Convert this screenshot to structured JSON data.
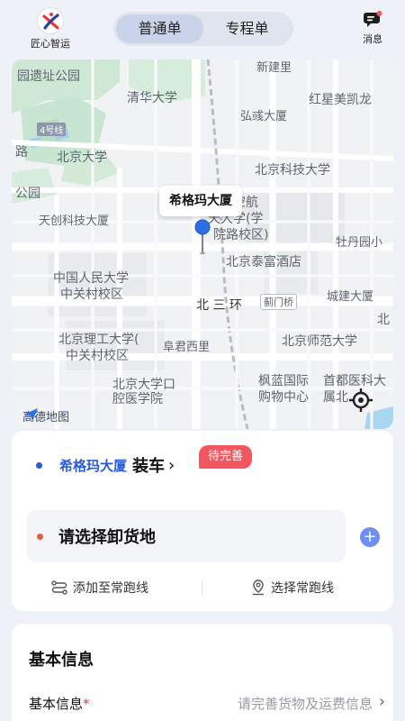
{
  "header": {
    "logo_text": "匠心智运",
    "tabs": [
      {
        "label": "普通单",
        "active": true
      },
      {
        "label": "专程单",
        "active": false
      }
    ],
    "message_label": "消息"
  },
  "map": {
    "labels": {
      "yuan": "园遗址公园",
      "xinjian": "新建里",
      "tsinghua": "清华大学",
      "hongxing": "红星美凯龙",
      "hongyu": "弘彧大厦",
      "road4": "4号线",
      "road_lu": "路",
      "pku": "北京大学",
      "ustb": "北京科技大学",
      "park": "公园",
      "tianchuang": "天创科技大厦",
      "beihang1": "航空航",
      "beihang2": "天大学(学",
      "beihang3": "院路校区)",
      "mudanyuan": "牡丹园小",
      "taifu": "北京泰富酒店",
      "renmin1": "中国人民大学",
      "renmin2": "中关村校区",
      "beisanhuan": "北 三 环",
      "jimenqiao": "蓟门桥",
      "chengjian": "城建大厦",
      "bei": "北",
      "bit1": "北京理工大学(",
      "bit2": "中关村校区",
      "fujun": "阜君西里",
      "bnu": "北京师范大学",
      "pkukq1": "北京大学口",
      "pkukq2": "腔医学院",
      "fenglan1": "枫蓝国际",
      "fenglan2": "购物中心",
      "shoudu1": "首都医科大",
      "shoudu2": "属北",
      "gaode": "高德地图"
    },
    "callout": "希格玛大厦"
  },
  "route": {
    "origin_name": "希格玛大厦",
    "origin_action": "装车",
    "origin_arrow": "›",
    "badge": "待完善",
    "destination_placeholder": "请选择卸货地",
    "add_to_routes": "添加至常跑线",
    "choose_route": "选择常跑线",
    "origin_dot_color": "#2a5bd7",
    "dest_dot_color": "#f05a3c"
  },
  "basic_info": {
    "title": "基本信息",
    "row_label": "基本信息",
    "row_required_mark": "*",
    "row_value": "请完善货物及运费信息",
    "row_chevron": "›"
  }
}
